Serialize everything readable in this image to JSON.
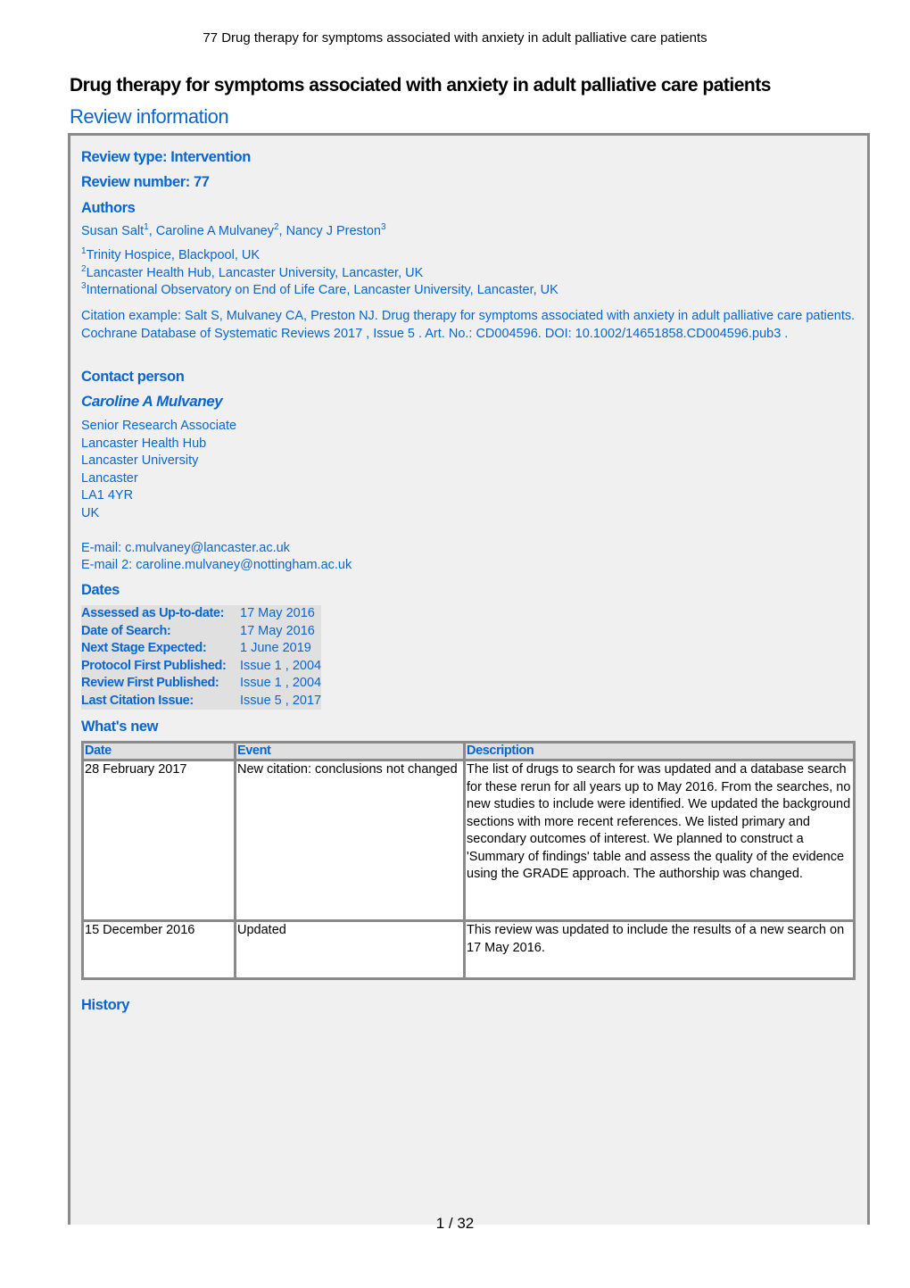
{
  "running_header": "77 Drug therapy for symptoms associated with anxiety in adult palliative care patients",
  "title": "Drug therapy for symptoms associated with anxiety in adult palliative care patients",
  "section_title": "Review information",
  "review_type": "Review type: Intervention",
  "review_number": "Review number: 77",
  "authors_heading": "Authors",
  "authors": [
    {
      "name": "Susan Salt",
      "sup": "1",
      "sep": ", "
    },
    {
      "name": "Caroline A Mulvaney",
      "sup": "2",
      "sep": ", "
    },
    {
      "name": "Nancy J Preston",
      "sup": "3",
      "sep": ""
    }
  ],
  "affiliations": [
    {
      "sup": "1",
      "text": "Trinity Hospice, Blackpool, UK"
    },
    {
      "sup": "2",
      "text": "Lancaster Health Hub, Lancaster University, Lancaster, UK"
    },
    {
      "sup": "3",
      "text": "International Observatory on End of Life Care, Lancaster University, Lancaster, UK"
    }
  ],
  "citation": "Citation example: Salt S, Mulvaney CA, Preston NJ. Drug therapy for symptoms associated with anxiety in adult palliative care patients. Cochrane Database of Systematic Reviews 2017 , Issue 5 . Art. No.: CD004596. DOI: 10.1002/14651858.CD004596.pub3 .",
  "contact": {
    "heading": "Contact person",
    "name": "Caroline A Mulvaney",
    "lines": [
      "Senior Research Associate",
      "Lancaster Health Hub",
      "Lancaster University",
      "Lancaster",
      "LA1 4YR",
      "UK",
      ""
    ],
    "email": "E-mail: c.mulvaney@lancaster.ac.uk",
    "email2": "E-mail 2: caroline.mulvaney@nottingham.ac.uk"
  },
  "dates": {
    "heading": "Dates",
    "rows": [
      {
        "label": "Assessed as Up-to-date:",
        "value": "17 May 2016"
      },
      {
        "label": "Date of Search:",
        "value": "17 May 2016"
      },
      {
        "label": "Next Stage Expected:",
        "value": "1 June 2019"
      },
      {
        "label": "Protocol First Published:",
        "value": "Issue 1 , 2004"
      },
      {
        "label": "Review First Published:",
        "value": "Issue 1 , 2004"
      },
      {
        "label": "Last Citation Issue:",
        "value": "Issue 5 , 2017"
      }
    ]
  },
  "whats_new": {
    "heading": "What's new",
    "columns": [
      "Date",
      "Event",
      "Description"
    ],
    "rows": [
      {
        "date": "28 February 2017",
        "event": "New citation: conclusions not changed",
        "description": "The list of drugs to search for was updated and a database search for these rerun for all years up to May 2016. From the searches, no new studies to include were identified. We updated the background sections with more recent references. We listed primary and secondary outcomes of interest. We planned to construct a 'Summary of findings' table and assess the quality of the evidence using the GRADE approach. The authorship was changed."
      },
      {
        "date": "15 December 2016",
        "event": "Updated",
        "description": "This review was updated to include the results of a new search on 17 May 2016."
      }
    ]
  },
  "history_heading": "History",
  "page_number": "1 / 32",
  "colors": {
    "accent": "#0a66cc",
    "box_bg": "#f0f0f0",
    "border": "#8a8a8a"
  }
}
